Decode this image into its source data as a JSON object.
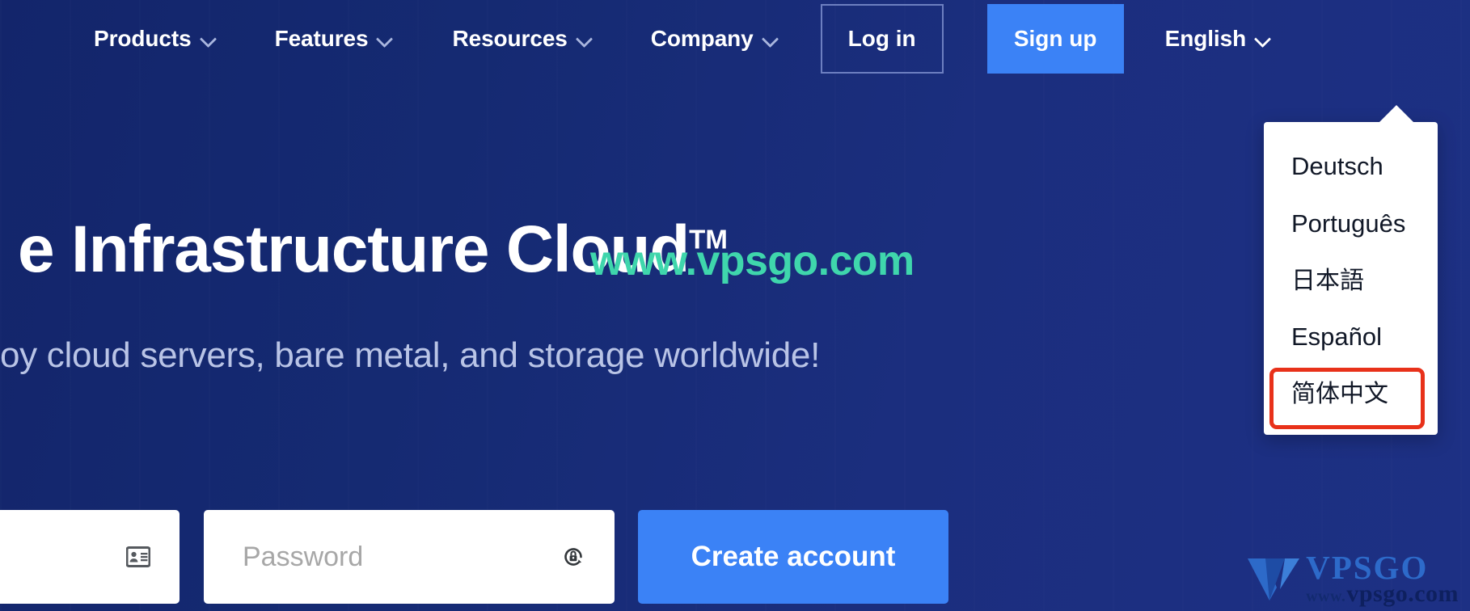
{
  "colors": {
    "background_dark": "#13256b",
    "background_light": "#1d3084",
    "accent_blue": "#3b82f6",
    "watermark_teal": "#3fd6ac",
    "annotation_red": "#e8311a",
    "menu_white": "#ffffff",
    "subtitle_blue": "#b9c4e6",
    "chevron_blue": "#a9b6de"
  },
  "nav": {
    "items": [
      {
        "label": "Products",
        "has_chevron": true,
        "chevron_icon": "chevron-down-icon"
      },
      {
        "label": "Features",
        "has_chevron": true,
        "chevron_icon": "chevron-down-icon"
      },
      {
        "label": "Resources",
        "has_chevron": true,
        "chevron_icon": "chevron-down-icon"
      },
      {
        "label": "Company",
        "has_chevron": true,
        "chevron_icon": "chevron-down-icon"
      }
    ],
    "login_label": "Log in",
    "signup_label": "Sign up",
    "language_label": "English",
    "language_chevron_icon": "chevron-down-icon"
  },
  "hero": {
    "title_text": "e Infrastructure Cloud",
    "title_trademark": "TM",
    "subtitle": "oy cloud servers, bare metal, and storage worldwide!"
  },
  "watermark": {
    "text": "www.vpsgo.com"
  },
  "signup_form": {
    "email_value": "",
    "email_placeholder": "",
    "email_icon": "contact-card-icon",
    "password_value": "",
    "password_placeholder": "Password",
    "password_icon": "lock-refresh-icon",
    "submit_label": "Create account"
  },
  "language_menu": {
    "open": true,
    "selected": "English",
    "highlighted": "简体中文",
    "items": [
      {
        "label": "Deutsch",
        "highlighted": false
      },
      {
        "label": "Português",
        "highlighted": false
      },
      {
        "label": "日本語",
        "highlighted": false
      },
      {
        "label": "Español",
        "highlighted": false
      },
      {
        "label": "简体中文",
        "highlighted": true
      }
    ]
  },
  "logo_watermark": {
    "brand": "VPSGO",
    "www_prefix": "www.",
    "domain": "vpsgo.com"
  }
}
